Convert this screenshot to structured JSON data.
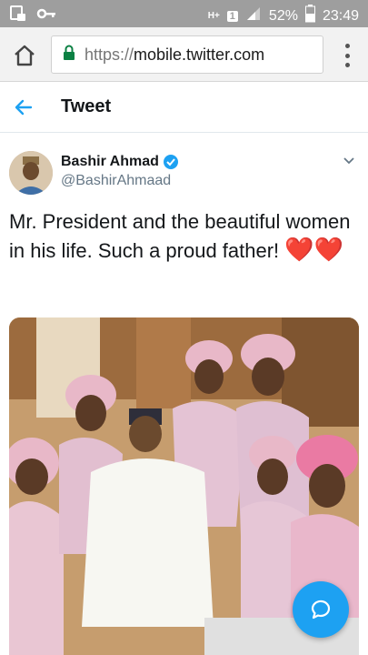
{
  "status_bar": {
    "battery_percent": "52%",
    "time": "23:49",
    "network_label": "H+",
    "sim_label": "1"
  },
  "browser": {
    "url_scheme": "https://",
    "url_host": "mobile.twitter.com"
  },
  "header": {
    "title": "Tweet"
  },
  "tweet": {
    "author_name": "Bashir Ahmad",
    "author_handle": "@BashirAhmaad",
    "text": "Mr. President and the beautiful women in his life. Such a proud father!",
    "emoji": "❤️❤️",
    "verified": true
  },
  "colors": {
    "twitter_blue": "#1da1f2",
    "heart_red": "#dd2e44",
    "status_bar": "#9e9e9e"
  },
  "icons": [
    "home-icon",
    "lock-icon",
    "more-vertical-icon",
    "back-arrow-icon",
    "verified-badge-icon",
    "chevron-down-icon",
    "reply-icon"
  ]
}
